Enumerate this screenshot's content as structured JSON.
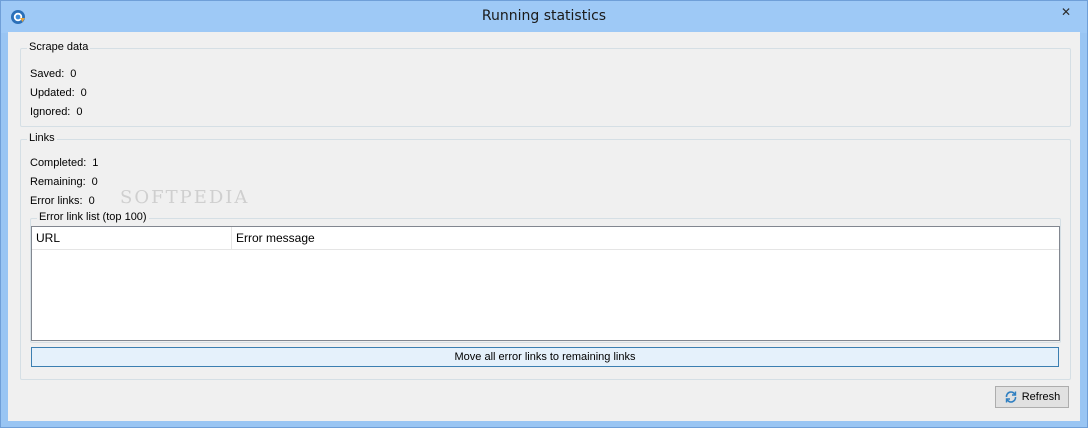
{
  "window": {
    "title": "Running statistics",
    "close_glyph": "✕",
    "app_icon": "globe-download-icon"
  },
  "scrape_data": {
    "group_label": "Scrape data",
    "rows": [
      {
        "label": "Saved:",
        "value": "0"
      },
      {
        "label": "Updated:",
        "value": "0"
      },
      {
        "label": "Ignored:",
        "value": "0"
      }
    ]
  },
  "links": {
    "group_label": "Links",
    "rows": [
      {
        "label": "Completed:",
        "value": "1"
      },
      {
        "label": "Remaining:",
        "value": "0"
      },
      {
        "label": "Error links:",
        "value": "0"
      }
    ],
    "error_list": {
      "group_label": "Error link list (top 100)",
      "columns": [
        "URL",
        "Error message"
      ],
      "rows": []
    },
    "move_button_label": "Move all error links to remaining links"
  },
  "footer": {
    "refresh_label": "Refresh",
    "refresh_icon": "refresh-icon"
  },
  "watermark": "SOFTPEDIA"
}
